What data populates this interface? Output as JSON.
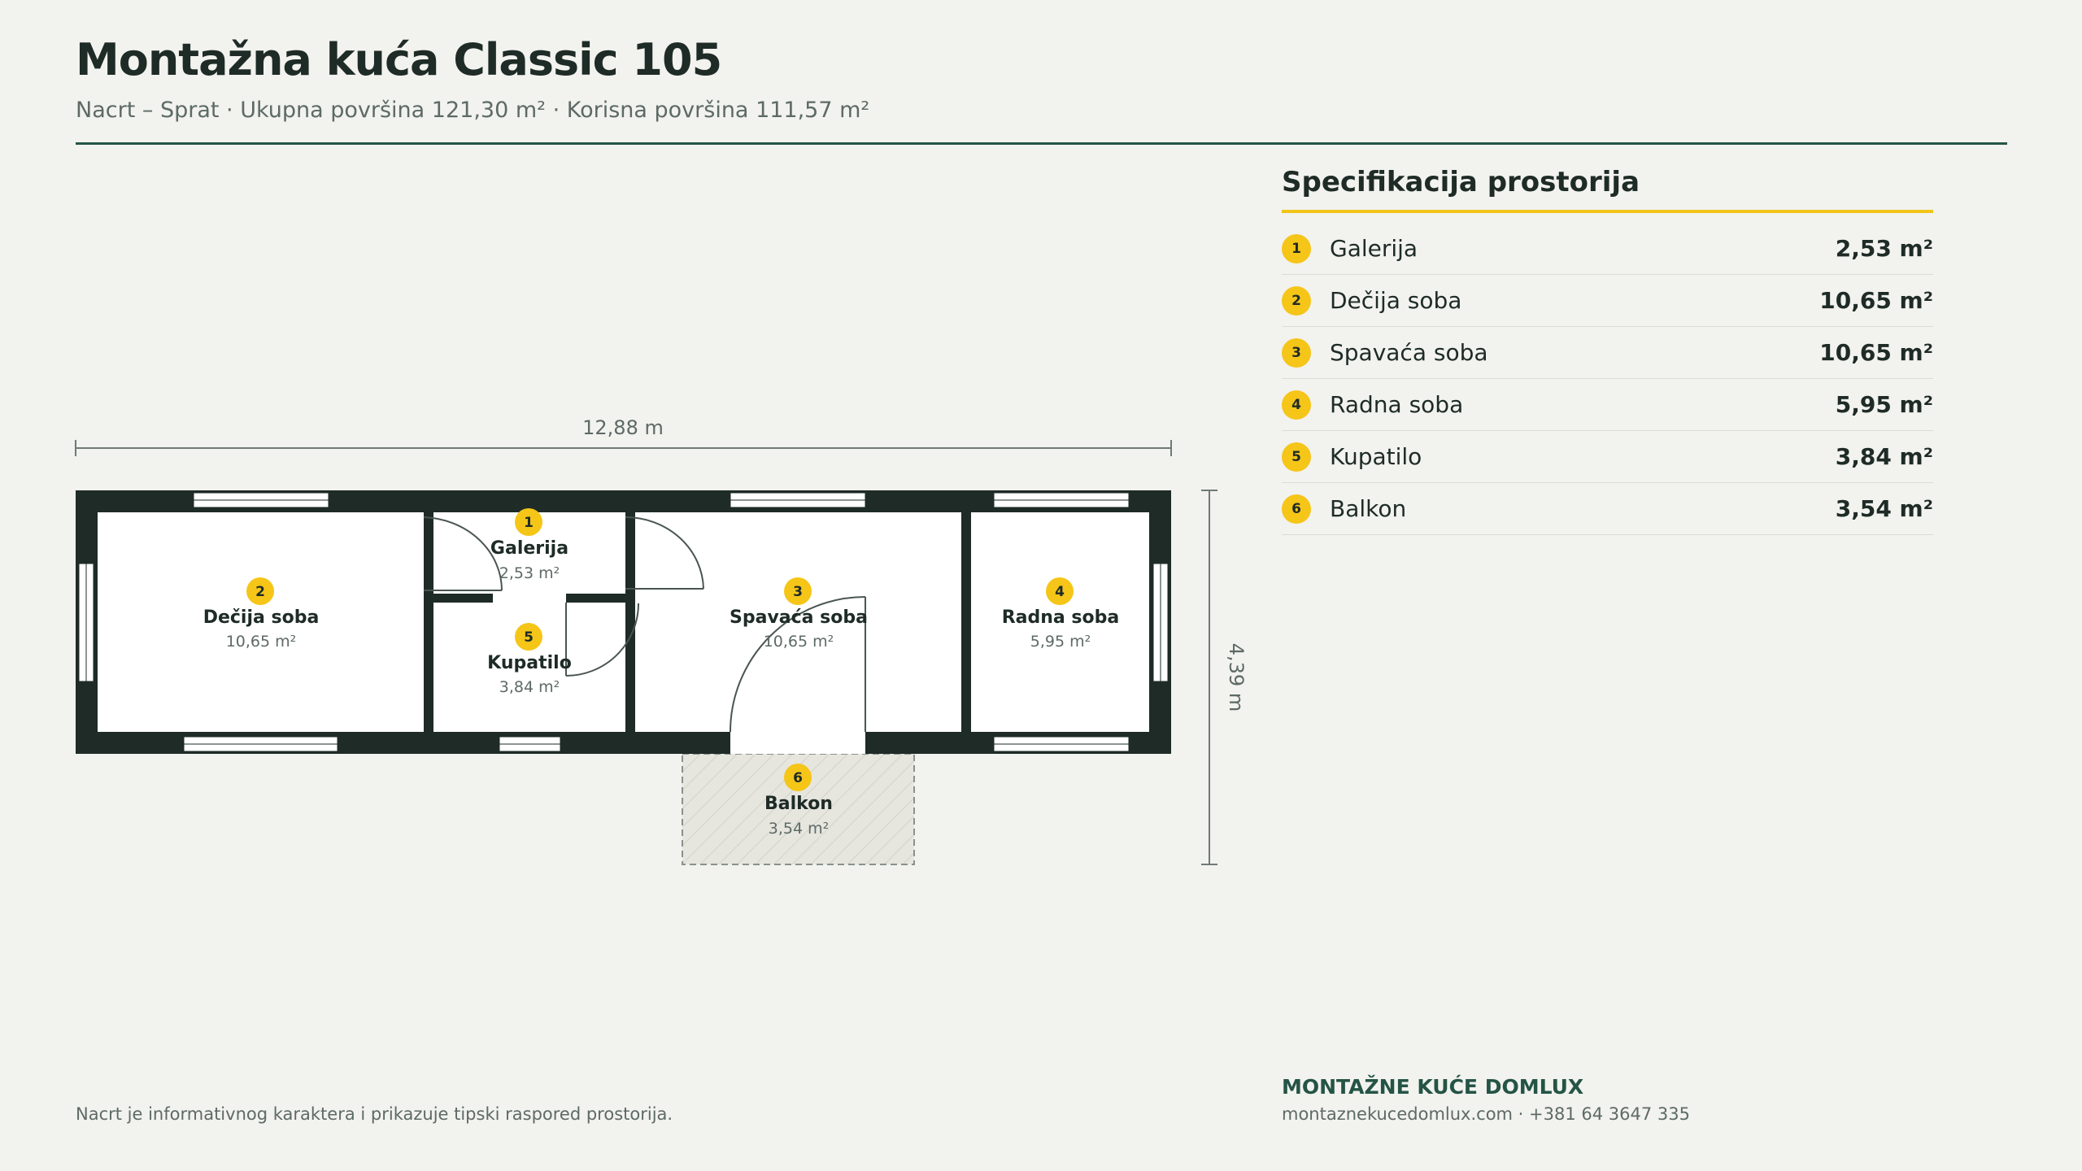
{
  "header": {
    "title": "Montažna kuća Classic 105",
    "subtitle": "Nacrt – Sprat · Ukupna površina 121,30 m² · Korisna površina 111,57 m²"
  },
  "plan": {
    "width_label": "12,88 m",
    "depth_label": "4,39 m",
    "rooms": [
      {
        "number": "1",
        "name": "Galerija",
        "area": "2,53 m²"
      },
      {
        "number": "2",
        "name": "Dečija soba",
        "area": "10,65 m²"
      },
      {
        "number": "3",
        "name": "Spavaća soba",
        "area": "10,65 m²"
      },
      {
        "number": "4",
        "name": "Radna soba",
        "area": "5,95 m²"
      },
      {
        "number": "5",
        "name": "Kupatilo",
        "area": "3,84 m²"
      },
      {
        "number": "6",
        "name": "Balkon",
        "area": "3,54 m²"
      }
    ]
  },
  "spec": {
    "title": "Specifikacija prostorija",
    "items": [
      {
        "number": "1",
        "name": "Galerija",
        "area": "2,53 m²"
      },
      {
        "number": "2",
        "name": "Dečija soba",
        "area": "10,65 m²"
      },
      {
        "number": "3",
        "name": "Spavaća soba",
        "area": "10,65 m²"
      },
      {
        "number": "4",
        "name": "Radna soba",
        "area": "5,95 m²"
      },
      {
        "number": "5",
        "name": "Kupatilo",
        "area": "3,84 m²"
      },
      {
        "number": "6",
        "name": "Balkon",
        "area": "3,54 m²"
      }
    ]
  },
  "footer": {
    "disclaimer": "Nacrt je informativnog karaktera i prikazuje tipski raspored prostorija.",
    "brand": "MONTAŽNE KUĆE DOMLUX",
    "contact": "montaznekucedomlux.com · +381 64 3647 335"
  },
  "colors": {
    "wall": "#1e2b27",
    "accent_yellow": "#f5c518",
    "brand_green": "#245446",
    "background": "#f2f2ee"
  }
}
